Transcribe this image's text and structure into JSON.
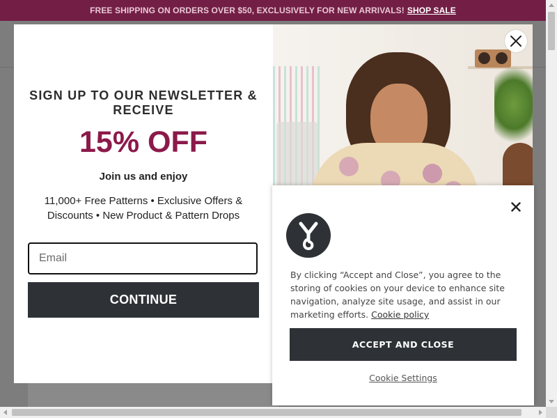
{
  "announcement": {
    "text": "FREE SHIPPING ON ORDERS OVER $50, EXCLUSIVELY FOR NEW ARRIVALS!",
    "link": "SHOP SALE"
  },
  "newsletter": {
    "heading": "SIGN UP TO OUR NEWSLETTER & RECEIVE",
    "offer": "15% OFF",
    "join": "Join us and enjoy",
    "description": "11,000+ Free Patterns • Exclusive Offers & Discounts • New Product & Pattern Drops",
    "email_placeholder": "Email",
    "continue_label": "CONTINUE",
    "close_icon": "close-icon"
  },
  "cookie": {
    "text": "By clicking “Accept and Close”, you agree to the storing of cookies on your device to enhance site navigation, analyze site usage, and assist in our marketing efforts.",
    "policy_link": "Cookie policy",
    "accept_label": "ACCEPT AND CLOSE",
    "settings_label": "Cookie Settings",
    "logo_icon": "brand-logo-icon",
    "close_icon": "close-icon"
  },
  "colors": {
    "announcement_bg": "#731f45",
    "offer": "#8b1a4a",
    "button_dark": "#2e3236"
  }
}
